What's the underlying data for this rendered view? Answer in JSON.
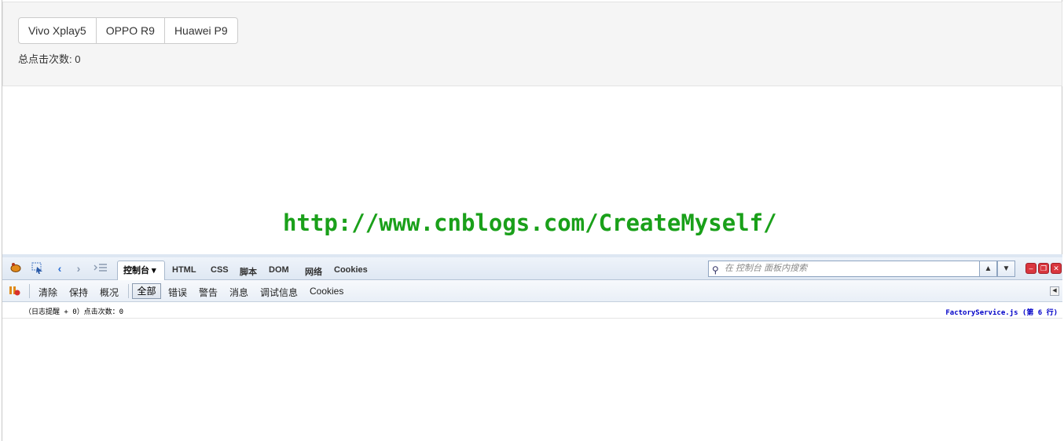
{
  "page": {
    "buttons": [
      "Vivo Xplay5",
      "OPPO R9",
      "Huawei P9"
    ],
    "total_clicks": "总点击次数: 0",
    "watermark": "http://www.cnblogs.com/CreateMyself/"
  },
  "firebug": {
    "toolbar": {
      "active_tab": "控制台 ▾",
      "tabs": [
        "HTML",
        "CSS",
        "脚本",
        "DOM",
        "网络",
        "Cookies"
      ],
      "search_placeholder": "在 控制台 面板内搜索",
      "icons": [
        "firebug-icon",
        "inspect-icon",
        "back-icon",
        "forward-icon",
        "command-line-icon"
      ]
    },
    "subtoolbar": {
      "items_left": [
        "清除",
        "保持",
        "概况"
      ],
      "active_filter": "全部",
      "filters": [
        "错误",
        "警告",
        "消息",
        "调试信息",
        "Cookies"
      ]
    },
    "log": {
      "message": "（日志提醒 + 0）点击次数：0",
      "source": "FactoryService.js (第 6 行)"
    }
  }
}
